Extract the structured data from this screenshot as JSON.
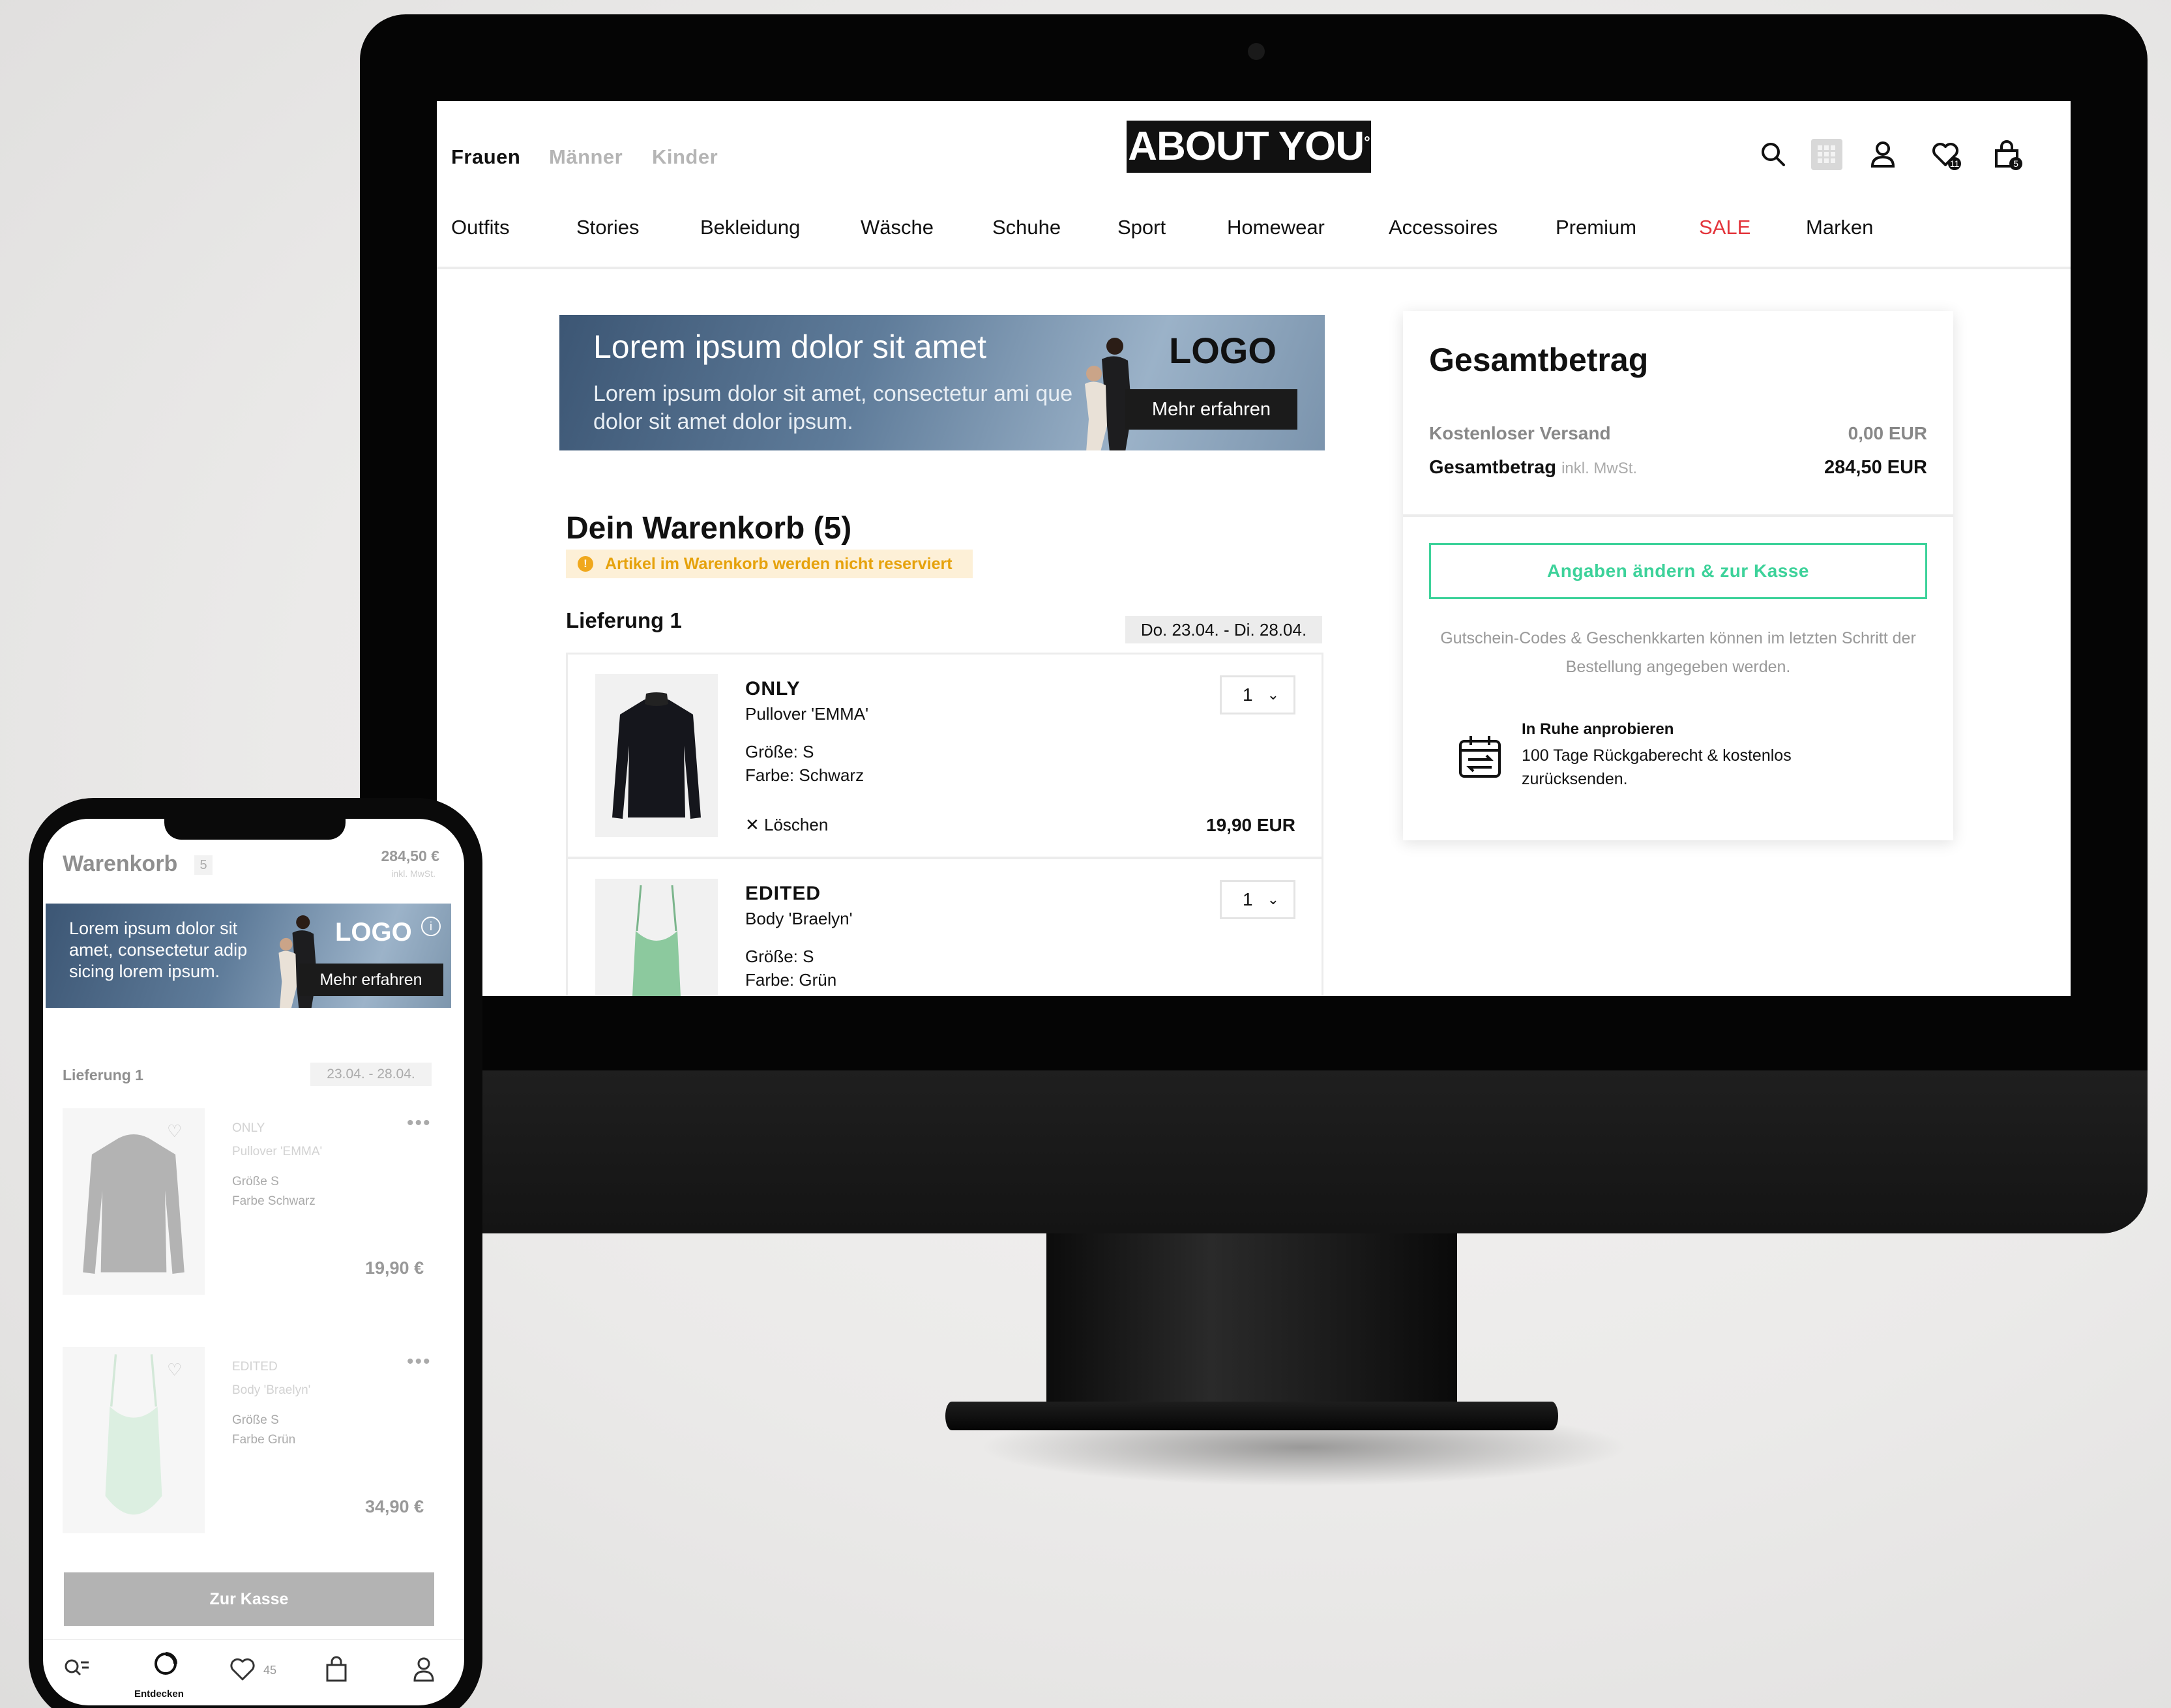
{
  "desktop": {
    "header": {
      "genders": [
        "Frauen",
        "Männer",
        "Kinder"
      ],
      "active_gender": "Frauen",
      "logo": "ABOUT YOU",
      "logo_mark": "°",
      "nav": [
        "Outfits",
        "Stories",
        "Bekleidung",
        "Wäsche",
        "Schuhe",
        "Sport",
        "Homewear",
        "Accessoires",
        "Premium",
        "SALE",
        "Marken"
      ],
      "sale_color": "#e3343b",
      "icons": [
        "search-icon",
        "grid-icon",
        "user-icon",
        "heart-icon",
        "bag-icon"
      ],
      "wishlist_count": "11",
      "bag_count": "5"
    },
    "banner": {
      "title": "Lorem ipsum dolor sit amet",
      "subtitle": "Lorem ipsum dolor sit amet, consectetur ami que dolor sit amet dolor ipsum.",
      "logo": "LOGO",
      "cta": "Mehr erfahren"
    },
    "cart": {
      "title": "Dein Warenkorb (5)",
      "warning": "Artikel im Warenkorb werden nicht reserviert",
      "delivery": "Lieferung 1",
      "delivery_date": "Do. 23.04. - Di. 28.04.",
      "items": [
        {
          "brand": "ONLY",
          "name": "Pullover 'EMMA'",
          "size": "Größe: S",
          "color": "Farbe: Schwarz",
          "qty": "1",
          "delete": "Löschen",
          "price": "19,90 EUR"
        },
        {
          "brand": "EDITED",
          "name": "Body 'Braelyn'",
          "size": "Größe: S",
          "color": "Farbe: Grün",
          "qty": "1"
        }
      ]
    },
    "summary": {
      "title": "Gesamtbetrag",
      "shipping_label": "Kostenloser Versand",
      "shipping_value": "0,00 EUR",
      "total_label": "Gesamtbetrag",
      "total_sub": "inkl. MwSt.",
      "total_value": "284,50 EUR",
      "cta": "Angaben ändern & zur Kasse",
      "cta_color": "#3dd29a",
      "note": "Gutschein-Codes & Geschenkkarten können im letzten Schritt der Bestellung angegeben werden.",
      "return_title": "In Ruhe anprobieren",
      "return_text": "100 Tage Rückgaberecht & kostenlos zurücksenden."
    }
  },
  "mobile": {
    "title": "Warenkorb",
    "count": "5",
    "total": "284,50 €",
    "total_sub": "inkl. MwSt.",
    "banner": {
      "text": "Lorem ipsum dolor sit amet, consectetur adip sicing lorem ipsum.",
      "logo": "LOGO",
      "cta": "Mehr erfahren"
    },
    "delivery": "Lieferung 1",
    "delivery_date": "23.04. - 28.04.",
    "items": [
      {
        "brand": "ONLY",
        "name": "Pullover 'EMMA'",
        "size": "Größe S",
        "color": "Farbe Schwarz",
        "price": "19,90 €"
      },
      {
        "brand": "EDITED",
        "name": "Body 'Braelyn'",
        "size": "Größe S",
        "color": "Farbe Grün",
        "price": "34,90 €"
      }
    ],
    "checkout": "Zur Kasse",
    "tabs": {
      "explore": "Entdecken",
      "wishlist_count": "45"
    }
  }
}
